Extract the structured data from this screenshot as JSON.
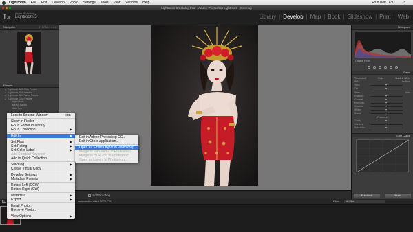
{
  "menubar": {
    "app": "Lightroom",
    "items": [
      "File",
      "Edit",
      "Develop",
      "Photo",
      "Settings",
      "Tools",
      "View",
      "Window",
      "Help"
    ],
    "clock": "Fri 8 Nov  14:11"
  },
  "window": {
    "title": "Lightroom 5 Catalog.lrcat - Adobe Photoshop Lightroom - Develop"
  },
  "identity": {
    "logo": "Lr",
    "brand": "Adobe Photoshop",
    "product": "Lightroom 5"
  },
  "modules": {
    "library": "Library",
    "develop": "Develop",
    "map": "Map",
    "book": "Book",
    "slideshow": "Slideshow",
    "print": "Print",
    "web": "Web",
    "sep": "|"
  },
  "left_panel": {
    "navigator": {
      "title": "Navigator",
      "options": "FIT  FILL  1:1  3:1"
    },
    "presets": {
      "title": "Presets",
      "items": [
        {
          "label": "Lightroom B&W Filter Presets",
          "sub": false
        },
        {
          "label": "Lightroom B&W Presets",
          "sub": false
        },
        {
          "label": "Lightroom B&W Toned Presets",
          "sub": false
        },
        {
          "label": "Lightroom Color Presets",
          "sub": false
        },
        {
          "label": "Aged Photo",
          "sub": true
        },
        {
          "label": "Bleach Bypass",
          "sub": true
        },
        {
          "label": "Cold Tone",
          "sub": true
        }
      ]
    }
  },
  "right_panel": {
    "histogram": "Histogram",
    "original_photo": "Original Photo",
    "basic": "Basic",
    "treatment": {
      "label": "Treatment :",
      "color": "Color",
      "bw": "Black & White"
    },
    "wb": {
      "label": "WB :",
      "value": "As Shot"
    },
    "sliders": [
      {
        "label": "Temp",
        "pos": 0.5
      },
      {
        "label": "Tint",
        "pos": 0.5
      }
    ],
    "tone": {
      "label": "Tone",
      "auto": "Auto"
    },
    "tone_sliders": [
      {
        "label": "Exposure",
        "pos": 0.5
      },
      {
        "label": "Contrast",
        "pos": 0.5
      },
      {
        "label": "Highlights",
        "pos": 0.5
      },
      {
        "label": "Shadows",
        "pos": 0.5
      },
      {
        "label": "Whites",
        "pos": 0.5
      },
      {
        "label": "Blacks",
        "pos": 0.5
      }
    ],
    "presence": "Presence",
    "presence_sliders": [
      {
        "label": "Clarity",
        "pos": 0.5
      },
      {
        "label": "Vibrance",
        "pos": 0.5
      },
      {
        "label": "Saturation",
        "pos": 0.5
      }
    ],
    "tone_curve": "Tone Curve",
    "previous": "Previous",
    "reset": "Reset"
  },
  "toolbar": {
    "soft_proofing": "Soft Proofing"
  },
  "filmstrip": {
    "num": "1",
    "file": "selected /untitled-8072.CR2",
    "filter_label": "Filter :",
    "filter_value": "No Filter"
  },
  "context_menu": [
    {
      "label": "Lock to Second Window",
      "shortcut": "⇧⌘↵"
    },
    {
      "sep": true
    },
    {
      "label": "Show in Finder"
    },
    {
      "label": "Go to Folder in Library"
    },
    {
      "label": "Go to Collection",
      "arrow": true
    },
    {
      "sep": true
    },
    {
      "label": "Edit In",
      "arrow": true,
      "highlighted": true
    },
    {
      "sep": true
    },
    {
      "label": "Set Flag",
      "arrow": true
    },
    {
      "label": "Set Rating",
      "arrow": true
    },
    {
      "label": "Set Color Label",
      "arrow": true
    },
    {
      "label": "Add Shortcut Keyword",
      "disabled": true
    },
    {
      "label": "Add to Quick Collection"
    },
    {
      "sep": true
    },
    {
      "label": "Stacking",
      "arrow": true
    },
    {
      "label": "Create Virtual Copy"
    },
    {
      "sep": true
    },
    {
      "label": "Develop Settings",
      "arrow": true
    },
    {
      "label": "Metadata Presets",
      "arrow": true
    },
    {
      "sep": true
    },
    {
      "label": "Rotate Left (CCW)"
    },
    {
      "label": "Rotate Right (CW)"
    },
    {
      "sep": true
    },
    {
      "label": "Metadata",
      "arrow": true
    },
    {
      "label": "Export",
      "arrow": true
    },
    {
      "sep": true
    },
    {
      "label": "Email Photo..."
    },
    {
      "label": "Remove Photo..."
    },
    {
      "sep": true
    },
    {
      "label": "View Options",
      "arrow": true
    }
  ],
  "submenu": [
    {
      "label": "Edit in Adobe Photoshop CC..."
    },
    {
      "label": "Edit in Other Application..."
    },
    {
      "sep": true
    },
    {
      "label": "Open as Smart Object in Photoshop...",
      "highlighted": true
    },
    {
      "label": "Merge to Panorama in Photoshop...",
      "disabled": true
    },
    {
      "label": "Merge to HDR Pro in Photoshop...",
      "disabled": true
    },
    {
      "label": "Open as Layers in Photoshop...",
      "disabled": true
    }
  ],
  "colors": {
    "highlight": "#3b79d6",
    "panel": "#3c3c3c",
    "center_bg": "#777777"
  }
}
